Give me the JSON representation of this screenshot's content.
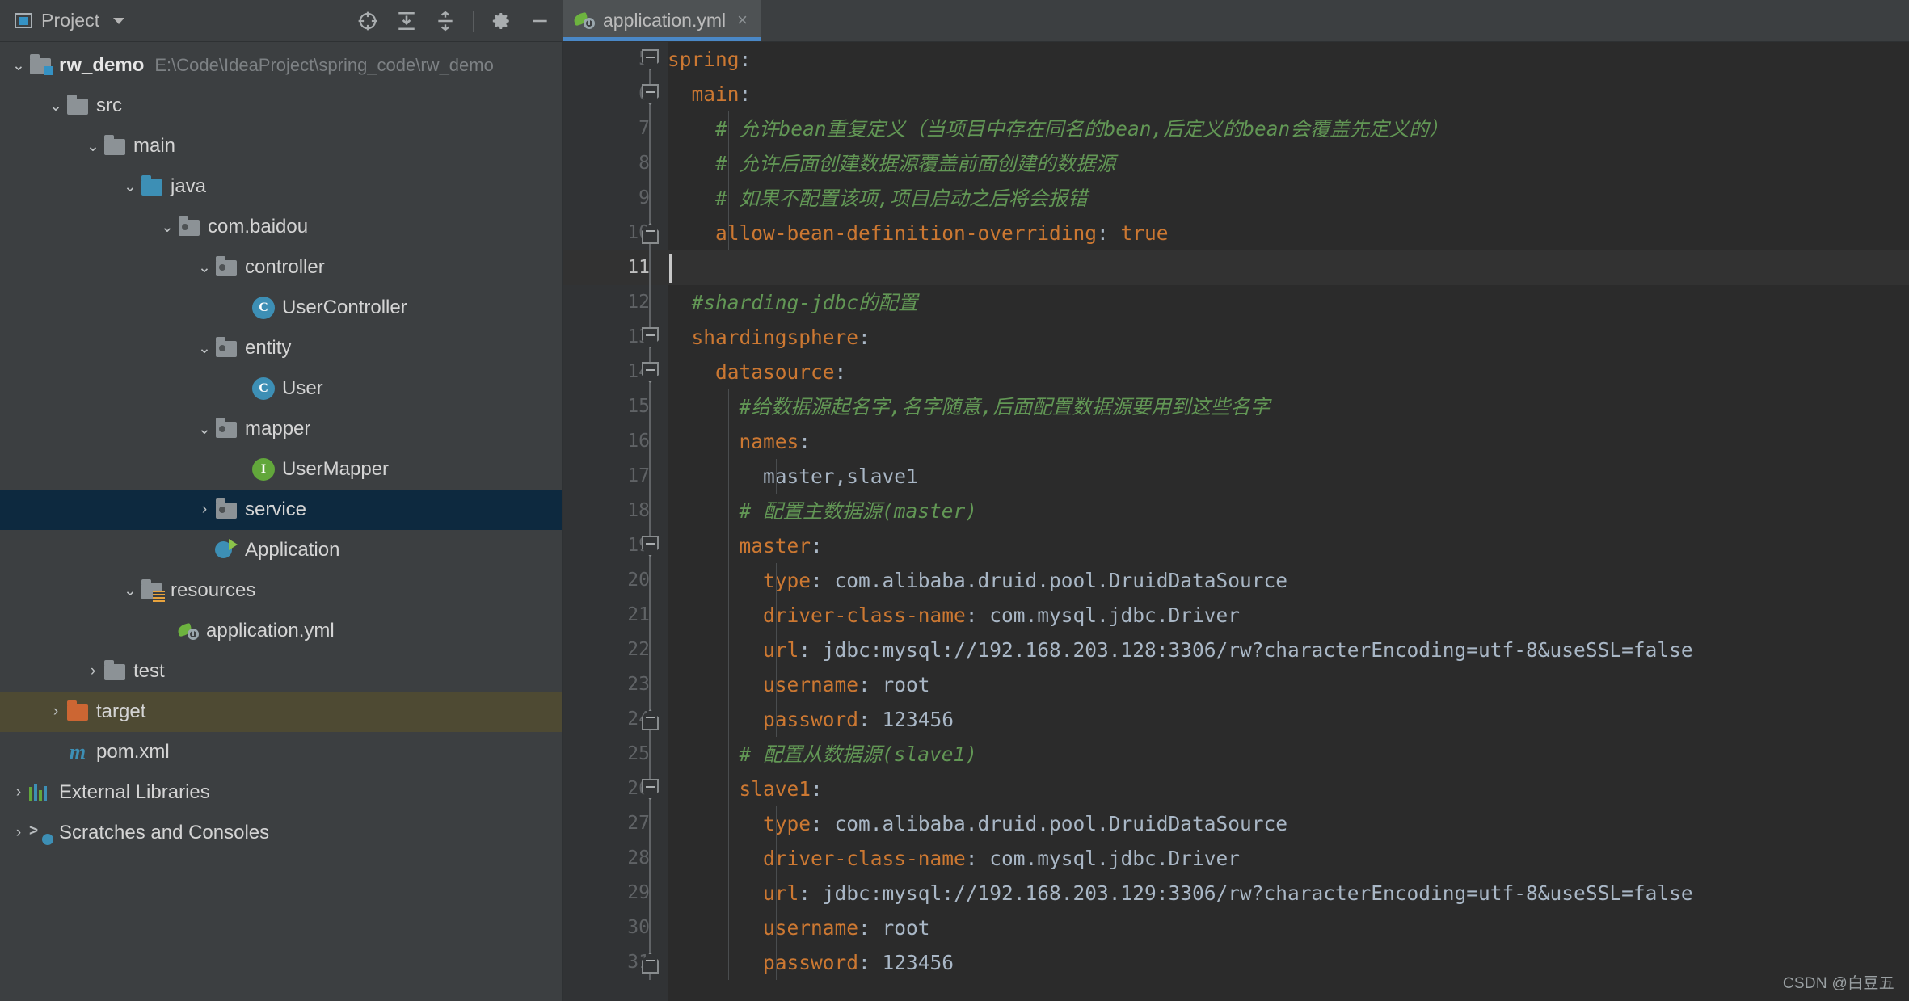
{
  "window": {
    "project_panel": {
      "title": "Project",
      "icons": [
        "project-window-icon",
        "chevron-down-icon",
        "locate-icon",
        "expand-all-icon",
        "collapse-all-icon",
        "settings-gear-icon",
        "hide-icon"
      ]
    },
    "tabs": [
      {
        "label": "application.yml",
        "icon": "spring-yaml-icon",
        "close": "×",
        "active": true
      }
    ]
  },
  "tree": [
    {
      "label": "rw_demo",
      "path": "E:\\Code\\IdeaProject\\spring_code\\rw_demo",
      "indent": 0,
      "arrow": "⌄",
      "icon": "module-folder-icon",
      "bold": true,
      "state": "none"
    },
    {
      "label": "src",
      "path": "",
      "indent": 1,
      "arrow": "⌄",
      "icon": "folder-icon",
      "bold": false,
      "state": "none"
    },
    {
      "label": "main",
      "path": "",
      "indent": 2,
      "arrow": "⌄",
      "icon": "folder-icon",
      "bold": false,
      "state": "none"
    },
    {
      "label": "java",
      "path": "",
      "indent": 3,
      "arrow": "⌄",
      "icon": "source-root-icon",
      "bold": false,
      "state": "none"
    },
    {
      "label": "com.baidou",
      "path": "",
      "indent": 4,
      "arrow": "⌄",
      "icon": "package-icon",
      "bold": false,
      "state": "none"
    },
    {
      "label": "controller",
      "path": "",
      "indent": 5,
      "arrow": "⌄",
      "icon": "package-icon",
      "bold": false,
      "state": "none"
    },
    {
      "label": "UserController",
      "path": "",
      "indent": 6,
      "arrow": "",
      "icon": "java-class-icon",
      "bold": false,
      "state": "none"
    },
    {
      "label": "entity",
      "path": "",
      "indent": 5,
      "arrow": "⌄",
      "icon": "package-icon",
      "bold": false,
      "state": "none"
    },
    {
      "label": "User",
      "path": "",
      "indent": 6,
      "arrow": "",
      "icon": "java-class-icon",
      "bold": false,
      "state": "none"
    },
    {
      "label": "mapper",
      "path": "",
      "indent": 5,
      "arrow": "⌄",
      "icon": "package-icon",
      "bold": false,
      "state": "none"
    },
    {
      "label": "UserMapper",
      "path": "",
      "indent": 6,
      "arrow": "",
      "icon": "java-interface-icon",
      "bold": false,
      "state": "none"
    },
    {
      "label": "service",
      "path": "",
      "indent": 5,
      "arrow": "›",
      "icon": "package-icon",
      "bold": false,
      "state": "selected"
    },
    {
      "label": "Application",
      "path": "",
      "indent": 5,
      "arrow": "",
      "icon": "spring-application-icon",
      "bold": false,
      "state": "none"
    },
    {
      "label": "resources",
      "path": "",
      "indent": 3,
      "arrow": "⌄",
      "icon": "resource-root-icon",
      "bold": false,
      "state": "none"
    },
    {
      "label": "application.yml",
      "path": "",
      "indent": 4,
      "arrow": "",
      "icon": "spring-yaml-icon",
      "bold": false,
      "state": "none"
    },
    {
      "label": "test",
      "path": "",
      "indent": 2,
      "arrow": "›",
      "icon": "folder-icon",
      "bold": false,
      "state": "none"
    },
    {
      "label": "target",
      "path": "",
      "indent": 1,
      "arrow": "›",
      "icon": "excluded-folder-icon",
      "bold": false,
      "state": "hover"
    },
    {
      "label": "pom.xml",
      "path": "",
      "indent": 1,
      "arrow": "",
      "icon": "maven-icon",
      "bold": false,
      "state": "none"
    },
    {
      "label": "External Libraries",
      "path": "",
      "indent": 0,
      "arrow": "›",
      "icon": "libraries-icon",
      "bold": false,
      "state": "none"
    },
    {
      "label": "Scratches and Consoles",
      "path": "",
      "indent": 0,
      "arrow": "›",
      "icon": "scratches-icon",
      "bold": false,
      "state": "none"
    }
  ],
  "editor": {
    "first_line_number": 5,
    "current_line": 11,
    "lines": [
      {
        "n": 5,
        "indent": 0,
        "fold": "start",
        "tokens": [
          {
            "t": "spring",
            "c": "k"
          },
          {
            "t": ":",
            "c": "p"
          }
        ]
      },
      {
        "n": 6,
        "indent": 1,
        "fold": "start",
        "tokens": [
          {
            "t": "main",
            "c": "k"
          },
          {
            "t": ":",
            "c": "p"
          }
        ]
      },
      {
        "n": 7,
        "indent": 2,
        "fold": "",
        "tokens": [
          {
            "t": "# 允许bean重复定义（当项目中存在同名的bean,后定义的bean会覆盖先定义的）",
            "c": "c"
          }
        ]
      },
      {
        "n": 8,
        "indent": 2,
        "fold": "",
        "tokens": [
          {
            "t": "# 允许后面创建数据源覆盖前面创建的数据源",
            "c": "c"
          }
        ]
      },
      {
        "n": 9,
        "indent": 2,
        "fold": "",
        "tokens": [
          {
            "t": "# 如果不配置该项,项目启动之后将会报错",
            "c": "c"
          }
        ]
      },
      {
        "n": 10,
        "indent": 2,
        "fold": "end",
        "tokens": [
          {
            "t": "allow-bean-definition-overriding",
            "c": "k"
          },
          {
            "t": ": ",
            "c": "p"
          },
          {
            "t": "true",
            "c": "k"
          }
        ]
      },
      {
        "n": 11,
        "indent": 0,
        "fold": "",
        "tokens": []
      },
      {
        "n": 12,
        "indent": 1,
        "fold": "",
        "tokens": [
          {
            "t": "#sharding-jdbc的配置",
            "c": "c"
          }
        ]
      },
      {
        "n": 13,
        "indent": 1,
        "fold": "start",
        "tokens": [
          {
            "t": "shardingsphere",
            "c": "k"
          },
          {
            "t": ":",
            "c": "p"
          }
        ]
      },
      {
        "n": 14,
        "indent": 2,
        "fold": "start",
        "tokens": [
          {
            "t": "datasource",
            "c": "k"
          },
          {
            "t": ":",
            "c": "p"
          }
        ]
      },
      {
        "n": 15,
        "indent": 3,
        "fold": "",
        "tokens": [
          {
            "t": "#给数据源起名字,名字随意,后面配置数据源要用到这些名字",
            "c": "c"
          }
        ]
      },
      {
        "n": 16,
        "indent": 3,
        "fold": "",
        "tokens": [
          {
            "t": "names",
            "c": "k"
          },
          {
            "t": ":",
            "c": "p"
          }
        ]
      },
      {
        "n": 17,
        "indent": 4,
        "fold": "",
        "tokens": [
          {
            "t": "master,slave1",
            "c": "v"
          }
        ]
      },
      {
        "n": 18,
        "indent": 3,
        "fold": "",
        "tokens": [
          {
            "t": "# 配置主数据源(master)",
            "c": "c"
          }
        ]
      },
      {
        "n": 19,
        "indent": 3,
        "fold": "start",
        "tokens": [
          {
            "t": "master",
            "c": "k"
          },
          {
            "t": ":",
            "c": "p"
          }
        ]
      },
      {
        "n": 20,
        "indent": 4,
        "fold": "",
        "tokens": [
          {
            "t": "type",
            "c": "k"
          },
          {
            "t": ": ",
            "c": "p"
          },
          {
            "t": "com.alibaba.druid.pool.DruidDataSource",
            "c": "v"
          }
        ]
      },
      {
        "n": 21,
        "indent": 4,
        "fold": "",
        "tokens": [
          {
            "t": "driver-class-name",
            "c": "k"
          },
          {
            "t": ": ",
            "c": "p"
          },
          {
            "t": "com.mysql.jdbc.Driver",
            "c": "v"
          }
        ]
      },
      {
        "n": 22,
        "indent": 4,
        "fold": "",
        "tokens": [
          {
            "t": "url",
            "c": "k"
          },
          {
            "t": ": ",
            "c": "p"
          },
          {
            "t": "jdbc:mysql://192.168.203.128:3306/rw?characterEncoding=utf-8&useSSL=false",
            "c": "v"
          }
        ]
      },
      {
        "n": 23,
        "indent": 4,
        "fold": "",
        "tokens": [
          {
            "t": "username",
            "c": "k"
          },
          {
            "t": ": ",
            "c": "p"
          },
          {
            "t": "root",
            "c": "v"
          }
        ]
      },
      {
        "n": 24,
        "indent": 4,
        "fold": "end",
        "tokens": [
          {
            "t": "password",
            "c": "k"
          },
          {
            "t": ": ",
            "c": "p"
          },
          {
            "t": "123456",
            "c": "v"
          }
        ]
      },
      {
        "n": 25,
        "indent": 3,
        "fold": "",
        "tokens": [
          {
            "t": "# 配置从数据源(slave1)",
            "c": "c"
          }
        ]
      },
      {
        "n": 26,
        "indent": 3,
        "fold": "start",
        "tokens": [
          {
            "t": "slave1",
            "c": "k"
          },
          {
            "t": ":",
            "c": "p"
          }
        ]
      },
      {
        "n": 27,
        "indent": 4,
        "fold": "",
        "tokens": [
          {
            "t": "type",
            "c": "k"
          },
          {
            "t": ": ",
            "c": "p"
          },
          {
            "t": "com.alibaba.druid.pool.DruidDataSource",
            "c": "v"
          }
        ]
      },
      {
        "n": 28,
        "indent": 4,
        "fold": "",
        "tokens": [
          {
            "t": "driver-class-name",
            "c": "k"
          },
          {
            "t": ": ",
            "c": "p"
          },
          {
            "t": "com.mysql.jdbc.Driver",
            "c": "v"
          }
        ]
      },
      {
        "n": 29,
        "indent": 4,
        "fold": "",
        "tokens": [
          {
            "t": "url",
            "c": "k"
          },
          {
            "t": ": ",
            "c": "p"
          },
          {
            "t": "jdbc:mysql://192.168.203.129:3306/rw?characterEncoding=utf-8&useSSL=false",
            "c": "v"
          }
        ]
      },
      {
        "n": 30,
        "indent": 4,
        "fold": "",
        "tokens": [
          {
            "t": "username",
            "c": "k"
          },
          {
            "t": ": ",
            "c": "p"
          },
          {
            "t": "root",
            "c": "v"
          }
        ]
      },
      {
        "n": 31,
        "indent": 4,
        "fold": "end",
        "tokens": [
          {
            "t": "password",
            "c": "k"
          },
          {
            "t": ": ",
            "c": "p"
          },
          {
            "t": "123456",
            "c": "v"
          }
        ]
      }
    ]
  },
  "watermark": "CSDN @白豆五",
  "colors": {
    "panel_bg": "#3c3f41",
    "editor_bg": "#2b2b2b",
    "gutter_bg": "#313335",
    "tab_active_underline": "#4a88c7",
    "selection_focus": "#0d293f",
    "selection_olive": "#4e4a33",
    "key": "#cc7832",
    "value": "#a9b7c6",
    "comment": "#629755"
  }
}
